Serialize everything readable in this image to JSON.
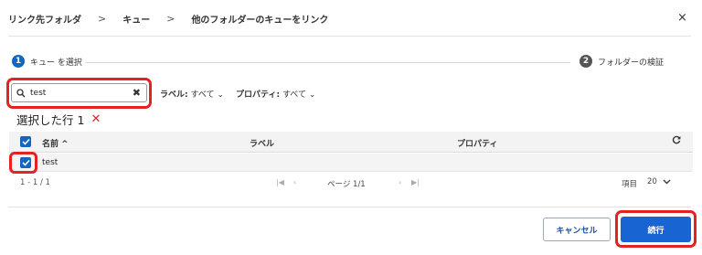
{
  "header": {
    "breadcrumb": [
      "リンク先フォルダ",
      "キュー",
      "他のフォルダーのキューをリンク"
    ],
    "separator": ">",
    "close": "×"
  },
  "stepper": {
    "steps": [
      {
        "number": "1",
        "label": "キュー を選択",
        "state": "active"
      },
      {
        "number": "2",
        "label": "フォルダーの検証",
        "state": "pending"
      }
    ]
  },
  "search": {
    "value": "test",
    "clear": "✖"
  },
  "filters": [
    {
      "name": "ラベル:",
      "value": "すべて"
    },
    {
      "name": "プロパティ:",
      "value": "すべて"
    }
  ],
  "selection": {
    "text": "選択した行 1",
    "remove": "✕"
  },
  "table": {
    "columns": [
      "名前 ^",
      "ラベル",
      "プロパティ"
    ],
    "rows": [
      {
        "name": "test",
        "label": "",
        "property": "",
        "checked": true
      }
    ],
    "refresh_icon": "refresh-icon"
  },
  "pagination": {
    "range": "1 - 1 / 1",
    "page": "ページ 1/1",
    "items_label": "項目",
    "items_value": "20"
  },
  "footer": {
    "cancel": "キャンセル",
    "next": "続行"
  },
  "colors": {
    "accent": "#1764d2",
    "highlight": "#e32222"
  }
}
